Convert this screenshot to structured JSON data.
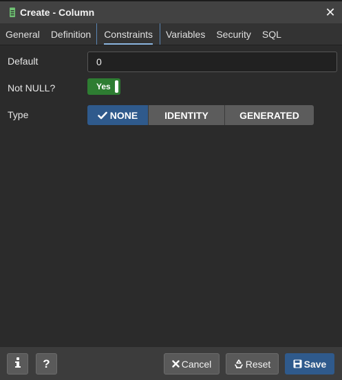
{
  "window": {
    "title": "Create - Column",
    "icon": "column-icon",
    "close_icon": "close-icon"
  },
  "tabs": [
    {
      "label": "General",
      "active": false
    },
    {
      "label": "Definition",
      "active": false
    },
    {
      "label": "Constraints",
      "active": true
    },
    {
      "label": "Variables",
      "active": false
    },
    {
      "label": "Security",
      "active": false
    },
    {
      "label": "SQL",
      "active": false
    }
  ],
  "form": {
    "default": {
      "label": "Default",
      "value": "0"
    },
    "not_null": {
      "label": "Not NULL?",
      "value": "Yes",
      "on": true
    },
    "type": {
      "label": "Type",
      "options": [
        "NONE",
        "IDENTITY",
        "GENERATED"
      ],
      "selected": "NONE"
    }
  },
  "footer": {
    "info_icon": "info-icon",
    "help_icon": "help-icon",
    "cancel_label": "Cancel",
    "reset_label": "Reset",
    "save_label": "Save"
  },
  "colors": {
    "accent": "#2f5a8c",
    "toggle_on": "#2e7d32",
    "background": "#2b2b2b"
  }
}
